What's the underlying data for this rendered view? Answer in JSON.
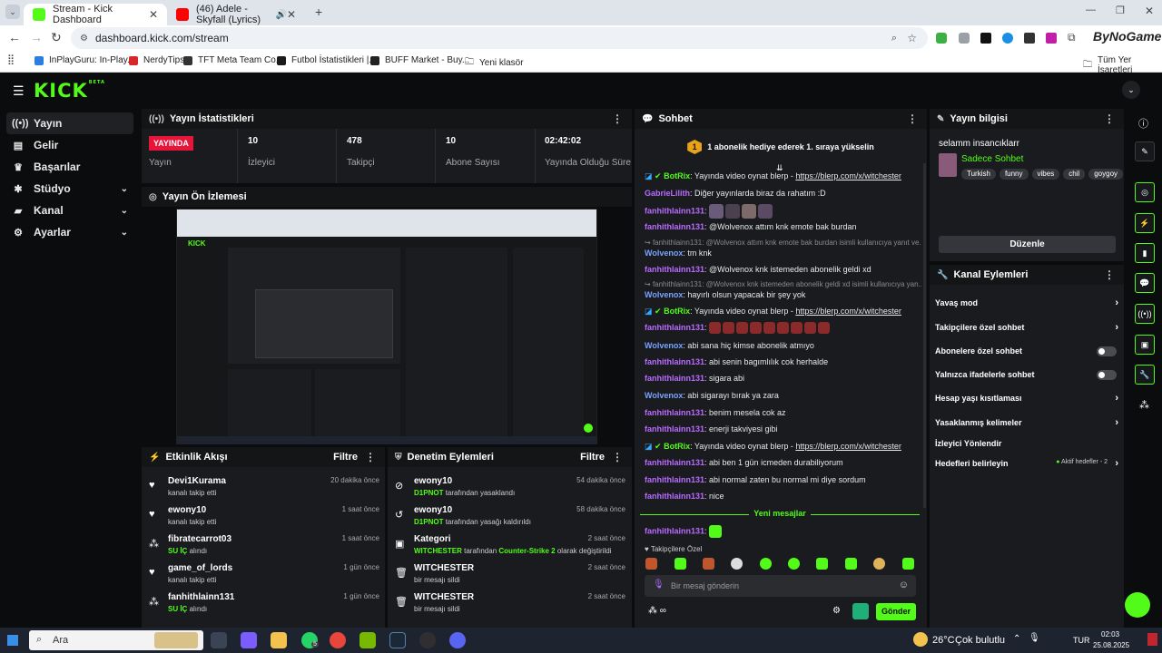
{
  "browser": {
    "tabs": [
      {
        "title": "Stream - Kick Dashboard"
      },
      {
        "title": "(46) Adele - Skyfall (Lyrics)"
      }
    ],
    "new_tab": "+",
    "url": "dashboard.kick.com/stream",
    "profile_badge": "ByNoGame",
    "bookmarks": [
      {
        "label": "InPlayGuru: In-Play..."
      },
      {
        "label": "NerdyTips"
      },
      {
        "label": "TFT Meta Team Co..."
      },
      {
        "label": "Futbol İstatistikleri |..."
      },
      {
        "label": "BUFF Market - Buy..."
      },
      {
        "label": "Yeni klasör"
      },
      {
        "label": "Tüm Yer İşaretleri"
      }
    ]
  },
  "app": {
    "logo": "KICK",
    "logo_badge": "BETA"
  },
  "sidebar": {
    "items": [
      {
        "label": "Yayın"
      },
      {
        "label": "Gelir"
      },
      {
        "label": "Başarılar"
      },
      {
        "label": "Stüdyo"
      },
      {
        "label": "Kanal"
      },
      {
        "label": "Ayarlar"
      }
    ]
  },
  "stats": {
    "title": "Yayın İstatistikleri",
    "live_badge": "YAYINDA",
    "status_label": "Yayın",
    "items": [
      {
        "value": "10",
        "label": "İzleyici"
      },
      {
        "value": "478",
        "label": "Takipçi"
      },
      {
        "value": "10",
        "label": "Abone Sayısı"
      },
      {
        "value": "02:42:02",
        "label": "Yayında Olduğu Süre"
      }
    ]
  },
  "preview": {
    "title": "Yayın Ön İzlemesi"
  },
  "activity": {
    "title": "Etkinlik Akışı",
    "filter": "Filtre",
    "events": [
      {
        "name": "Devi1Kurama",
        "desc": "kanalı takip etti",
        "time": "20 dakika önce"
      },
      {
        "name": "ewony10",
        "desc": "kanalı takip etti",
        "time": "1 saat önce"
      },
      {
        "name": "fibratecarrot03",
        "desc": "SU İÇ",
        "desc2": "alındı",
        "time": "1 saat önce"
      },
      {
        "name": "game_of_lords",
        "desc": "kanalı takip etti",
        "time": "1 gün önce"
      },
      {
        "name": "fanhithlainn131",
        "desc": "SU İÇ",
        "desc2": "alındı",
        "time": "1 gün önce"
      }
    ]
  },
  "moderation": {
    "title": "Denetim Eylemleri",
    "filter": "Filtre",
    "events": [
      {
        "name": "ewony10",
        "actor": "D1PNOT",
        "desc": "tarafından yasaklandı",
        "time": "54 dakika önce"
      },
      {
        "name": "ewony10",
        "actor": "D1PNOT",
        "desc": "tarafından yasağı kaldırıldı",
        "time": "58 dakika önce"
      },
      {
        "name": "Kategori",
        "actor": "WITCHESTER",
        "desc": "tarafından",
        "target": "Counter-Strike 2",
        "desc2": "olarak değiştirildi",
        "time": "2 saat önce"
      },
      {
        "name": "WITCHESTER",
        "desc": "bir mesajı sildi",
        "time": "2 saat önce"
      },
      {
        "name": "WITCHESTER",
        "desc": "bir mesajı sildi",
        "time": "2 saat önce"
      }
    ]
  },
  "chat": {
    "title": "Sohbet",
    "gift_banner": "1 abonelik hediye ederek 1. sıraya yükselin",
    "gift_rank": "1",
    "new_messages": "Yeni mesajlar",
    "followers_only": "Takipçilere Özel",
    "input_placeholder": "Bir mesaj gönderin",
    "send": "Gönder",
    "messages": [
      {
        "user": "BotRix",
        "text": ": Yayında video oynat blerp - ",
        "link": "https://blerp.com/x/witchester"
      },
      {
        "user": "GabrieLilith",
        "text": ": Diğer yayınlarda biraz da rahatım :D"
      },
      {
        "user": "fanhithlainn131",
        "text": ": "
      },
      {
        "user": "fanhithlainn131",
        "text": ": @Wolvenox attım knk emote bak burdan"
      },
      {
        "reply": "fanhithlainn131: @Wolvenox attım knk emote bak burdan isimli kullanıcıya yanıt ve..."
      },
      {
        "user": "Wolvenox",
        "text": ": tm knk"
      },
      {
        "user": "fanhithlainn131",
        "text": ": @Wolvenox knk istemeden abonelik geldi xd"
      },
      {
        "reply": "fanhithlainn131: @Wolvenox knk istemeden abonelik geldi xd isimli kullanıcıya yan..."
      },
      {
        "user": "Wolvenox",
        "text": ": hayırlı olsun yapacak bir şey yok"
      },
      {
        "user": "BotRix",
        "text": ": Yayında video oynat blerp - ",
        "link": "https://blerp.com/x/witchester"
      },
      {
        "user": "fanhithlainn131",
        "text": ": "
      },
      {
        "user": "Wolvenox",
        "text": ": abi sana hiç kimse abonelik atmıyo"
      },
      {
        "user": "fanhithlainn131",
        "text": ": abi senin bagımlılık cok herhalde"
      },
      {
        "user": "fanhithlainn131",
        "text": ": sigara abi"
      },
      {
        "user": "Wolvenox",
        "text": ": abi sigarayı bırak ya zara"
      },
      {
        "user": "fanhithlainn131",
        "text": ": benim mesela cok az"
      },
      {
        "user": "fanhithlainn131",
        "text": ": enerji takviyesi gibi"
      },
      {
        "user": "BotRix",
        "text": ": Yayında video oynat blerp - ",
        "link": "https://blerp.com/x/witchester"
      },
      {
        "user": "fanhithlainn131",
        "text": ": abi ben 1 gün icmeden durabiliyorum"
      },
      {
        "user": "fanhithlainn131",
        "text": ": abi normal zaten bu normal mi diye sordum"
      },
      {
        "user": "fanhithlainn131",
        "text": ": nice"
      },
      {
        "user": "fanhithlainn131",
        "text": ": "
      }
    ]
  },
  "stream_info": {
    "title": "Yayın bilgisi",
    "stream_title": "selamm insancıklarr",
    "category": "Sadece Sohbet",
    "tags": [
      "Turkish",
      "funny",
      "vibes",
      "chil",
      "goygoy"
    ],
    "edit_button": "Düzenle"
  },
  "channel_actions": {
    "title": "Kanal Eylemleri",
    "items": [
      {
        "label": "Yavaş mod"
      },
      {
        "label": "Takipçilere özel sohbet"
      },
      {
        "label": "Abonelere özel sohbet"
      },
      {
        "label": "Yalnızca ifadelerle sohbet"
      },
      {
        "label": "Hesap yaşı kısıtlaması"
      },
      {
        "label": "Yasaklanmış kelimeler"
      },
      {
        "label": "İzleyici Yönlendir"
      },
      {
        "label": "Hedefleri belirleyin"
      }
    ],
    "goals_status": "Aktif hedefler - 2"
  },
  "taskbar": {
    "search_placeholder": "Ara",
    "weather": "26°C",
    "weather_desc": "Çok bulutlu",
    "lang": "TUR",
    "time": "02:03",
    "date": "25.08.2025",
    "whatsapp_badge": "5"
  },
  "colors": {
    "accent": "#53fc18",
    "live": "#e8143a",
    "username_purple": "#b96bff",
    "username_blue": "#7aa2ff",
    "panel": "#191b1f",
    "background": "#0b0c0d"
  }
}
